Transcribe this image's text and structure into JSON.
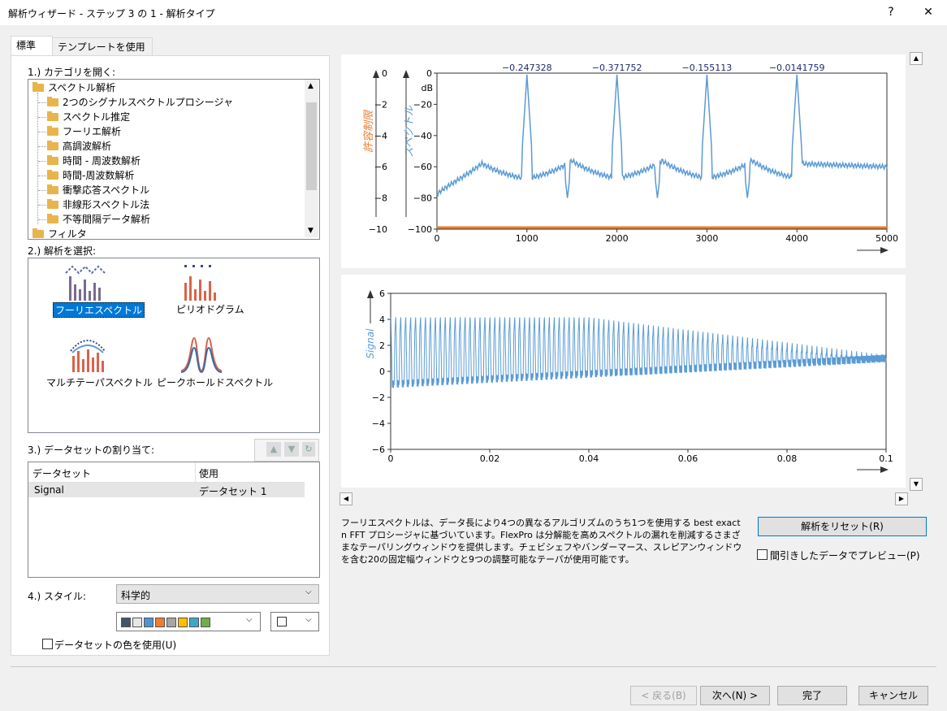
{
  "window": {
    "title": "解析ウィザード - ステップ 3 の 1 - 解析タイプ",
    "help": "?",
    "close": "✕"
  },
  "tabs": [
    {
      "label": "標準"
    },
    {
      "label": "テンプレートを使用する"
    }
  ],
  "section1": {
    "label": "1.) カテゴリを開く:"
  },
  "tree": [
    {
      "label": "スペクトル解析",
      "level": 0
    },
    {
      "label": "2つのシグナルスペクトルプロシージャ",
      "level": 1
    },
    {
      "label": "スペクトル推定",
      "level": 1
    },
    {
      "label": "フーリエ解析",
      "level": 1
    },
    {
      "label": "高調波解析",
      "level": 1
    },
    {
      "label": "時間 - 周波数解析",
      "level": 1
    },
    {
      "label": "時間-周波数解析",
      "level": 1
    },
    {
      "label": "衝撃応答スペクトル",
      "level": 1
    },
    {
      "label": "非線形スペクトル法",
      "level": 1
    },
    {
      "label": "不等間隔データ解析",
      "level": 1
    },
    {
      "label": "フィルタ",
      "level": 0
    }
  ],
  "section2": {
    "label": "2.) 解析を選択:"
  },
  "analyses": [
    {
      "label": "フーリエスペクトル",
      "selected": true
    },
    {
      "label": "ピリオドグラム",
      "selected": false
    },
    {
      "label": "マルチテーパスペクトル",
      "selected": false
    },
    {
      "label": "ピークホールドスペクトル",
      "selected": false
    }
  ],
  "section3": {
    "label": "3.) データセットの割り当て:"
  },
  "dataset_table": {
    "columns": [
      "データセット",
      "使用"
    ],
    "rows": [
      [
        "Signal",
        "データセット 1"
      ]
    ]
  },
  "section4": {
    "label": "4.) スタイル:",
    "style_value": "科学的"
  },
  "palette": [
    "#44546a",
    "#e7e6e6",
    "#4f93d2",
    "#ed7d31",
    "#a5a5a5",
    "#ffc000",
    "#3fa6c9",
    "#70ad47"
  ],
  "use_dataset_color": {
    "label": "データセットの色を使用(U)",
    "checked": false
  },
  "chart_data": [
    {
      "type": "line",
      "title": "",
      "ylabel_left": "許容制限",
      "ylabel_right": "スペクトル",
      "unit": "dB",
      "xlim": [
        0,
        5000
      ],
      "xticks": [
        "0",
        "1000",
        "2000",
        "3000",
        "4000",
        "5000"
      ],
      "yticks_left": [
        "0",
        "−2",
        "−4",
        "−6",
        "−8",
        "−10"
      ],
      "yticks_right": [
        "0",
        "−20",
        "−40",
        "−60",
        "−80",
        "−100"
      ],
      "ylim_right": [
        -100,
        0
      ],
      "peak_labels": [
        {
          "x": 1000,
          "text": "−0.247328"
        },
        {
          "x": 2000,
          "text": "−0.371752"
        },
        {
          "x": 3000,
          "text": "−0.155113"
        },
        {
          "x": 4000,
          "text": "−0.0141759"
        }
      ],
      "colors": {
        "spectrum": "#5b9bd5",
        "limit": "#ed7d31"
      }
    },
    {
      "type": "line",
      "ylabel": "Signal",
      "xlim": [
        0,
        0.1
      ],
      "ylim": [
        -6,
        6
      ],
      "xticks": [
        "0",
        "0.02",
        "0.04",
        "0.06",
        "0.08",
        "0.1"
      ],
      "yticks": [
        "6",
        "4",
        "2",
        "0",
        "−2",
        "−4",
        "−6"
      ],
      "colors": {
        "signal": "#5b9bd5"
      }
    }
  ],
  "description": "フーリエスペクトルは、データ長により4つの異なるアルゴリズムのうち1つを使用する best exact n FFT プロシージャに基づいています。FlexPro は分解能を高めスペクトルの漏れを削減するさまざまなテーパリングウィンドウを提供します。チェビシェフやバンダーマース、スレピアンウィンドウを含む20の固定幅ウィンドウと9つの調整可能なテーパが使用可能です。",
  "reset_button": "解析をリセット(R)",
  "preview_decimated": {
    "label": "間引きしたデータでプレビュー(P)",
    "checked": false
  },
  "footer": {
    "back": "< 戻る(B)",
    "next": "次へ(N) >",
    "finish": "完了",
    "cancel": "キャンセル"
  }
}
